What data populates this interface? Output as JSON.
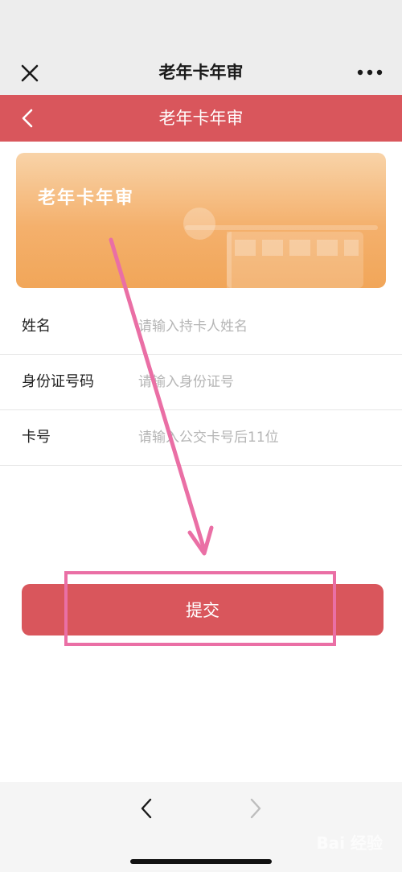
{
  "wechat_header": {
    "title": "老年卡年审",
    "close_icon": "close-icon",
    "more_icon": "more-dots-icon"
  },
  "app_bar": {
    "title": "老年卡年审",
    "back_icon": "chevron-left-icon",
    "color": "#d9565c"
  },
  "banner": {
    "title": "老年卡年审"
  },
  "form": {
    "fields": [
      {
        "label": "姓名",
        "placeholder": "请输入持卡人姓名",
        "value": ""
      },
      {
        "label": "身份证号码",
        "placeholder": "请输入身份证号",
        "value": ""
      },
      {
        "label": "卡号",
        "placeholder": "请输入公交卡号后11位",
        "value": ""
      }
    ]
  },
  "submit": {
    "label": "提交"
  },
  "annotation": {
    "color": "#ea6fa5"
  },
  "bottom_nav": {
    "back_icon": "chevron-left-icon",
    "forward_icon": "chevron-right-icon"
  },
  "watermark": {
    "text": "Bai 经验"
  }
}
